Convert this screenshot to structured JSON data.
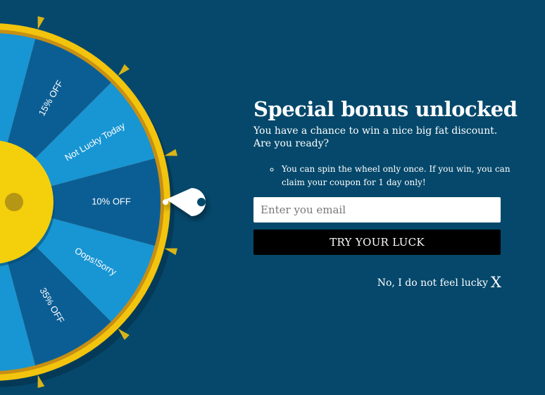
{
  "popup": {
    "title": "Special bonus unlocked",
    "subtitle_line1": "You have a chance to win a nice big fat discount.",
    "subtitle_line2": "Are you ready?",
    "rules": [
      "You can spin the wheel only once. If you win, you can claim your coupon for 1 day only!"
    ],
    "email_placeholder": "Enter you email",
    "email_value": "",
    "cta_label": "TRY YOUR LUCK",
    "decline_label": "No, I do not feel lucky",
    "close_label": "X"
  },
  "wheel": {
    "segments": [
      {
        "label": "10% OFF",
        "color": "#0b5e94"
      },
      {
        "label": "Not Lucky Today",
        "color": "#1895d3"
      },
      {
        "label": "15% OFF",
        "color": "#0b5e94"
      },
      {
        "label": "Oops!Sorry",
        "color": "#1895d3"
      },
      {
        "label": "",
        "color": "#0b5e94"
      },
      {
        "label": "",
        "color": "#1895d3"
      },
      {
        "label": "",
        "color": "#0b5e94"
      },
      {
        "label": "",
        "color": "#1895d3"
      },
      {
        "label": "",
        "color": "#0b5e94"
      },
      {
        "label": "Not Lucky Today",
        "color": "#1895d3"
      },
      {
        "label": "35% OFF",
        "color": "#0b5e94"
      },
      {
        "label": "Oops!Sorry",
        "color": "#1895d3"
      }
    ],
    "pointer_icon": "wheel-pointer-icon"
  },
  "colors": {
    "background": "#05486b",
    "rim_gold": "#f2c40d",
    "rim_dark_gold": "#c78f14",
    "hub_yellow": "#f4cf0b",
    "hub_center": "#b59615",
    "cta_background": "#000000"
  }
}
